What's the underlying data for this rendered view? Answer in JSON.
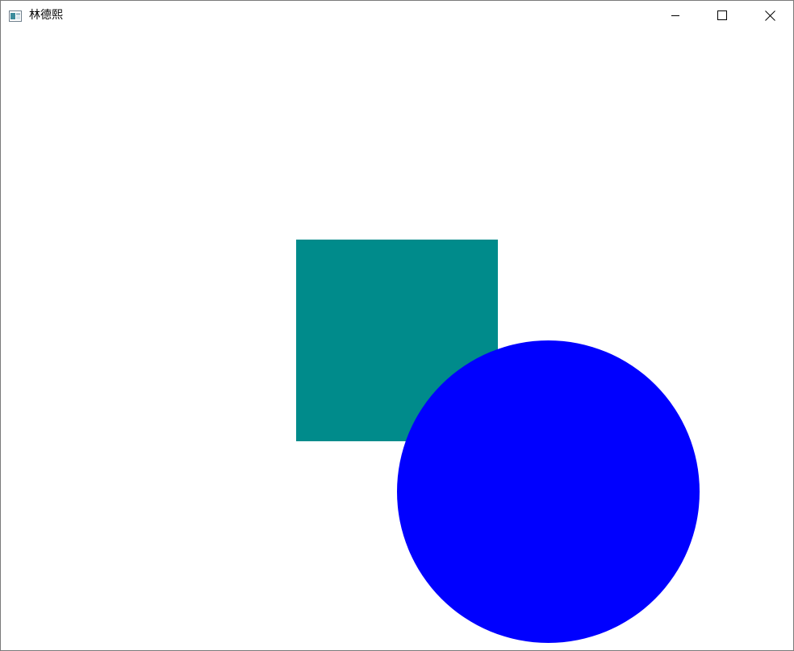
{
  "window": {
    "title": "林德熙",
    "app_icon": "app-window-icon",
    "controls": {
      "minimize_icon": "minimize-icon",
      "maximize_icon": "maximize-icon",
      "close_icon": "close-icon"
    }
  },
  "canvas": {
    "background_color": "#ffffff",
    "shapes": [
      {
        "name": "teal-square",
        "shape": "square",
        "color": "#008B8B"
      },
      {
        "name": "blue-circle",
        "shape": "circle",
        "color": "#0000FF"
      }
    ]
  }
}
